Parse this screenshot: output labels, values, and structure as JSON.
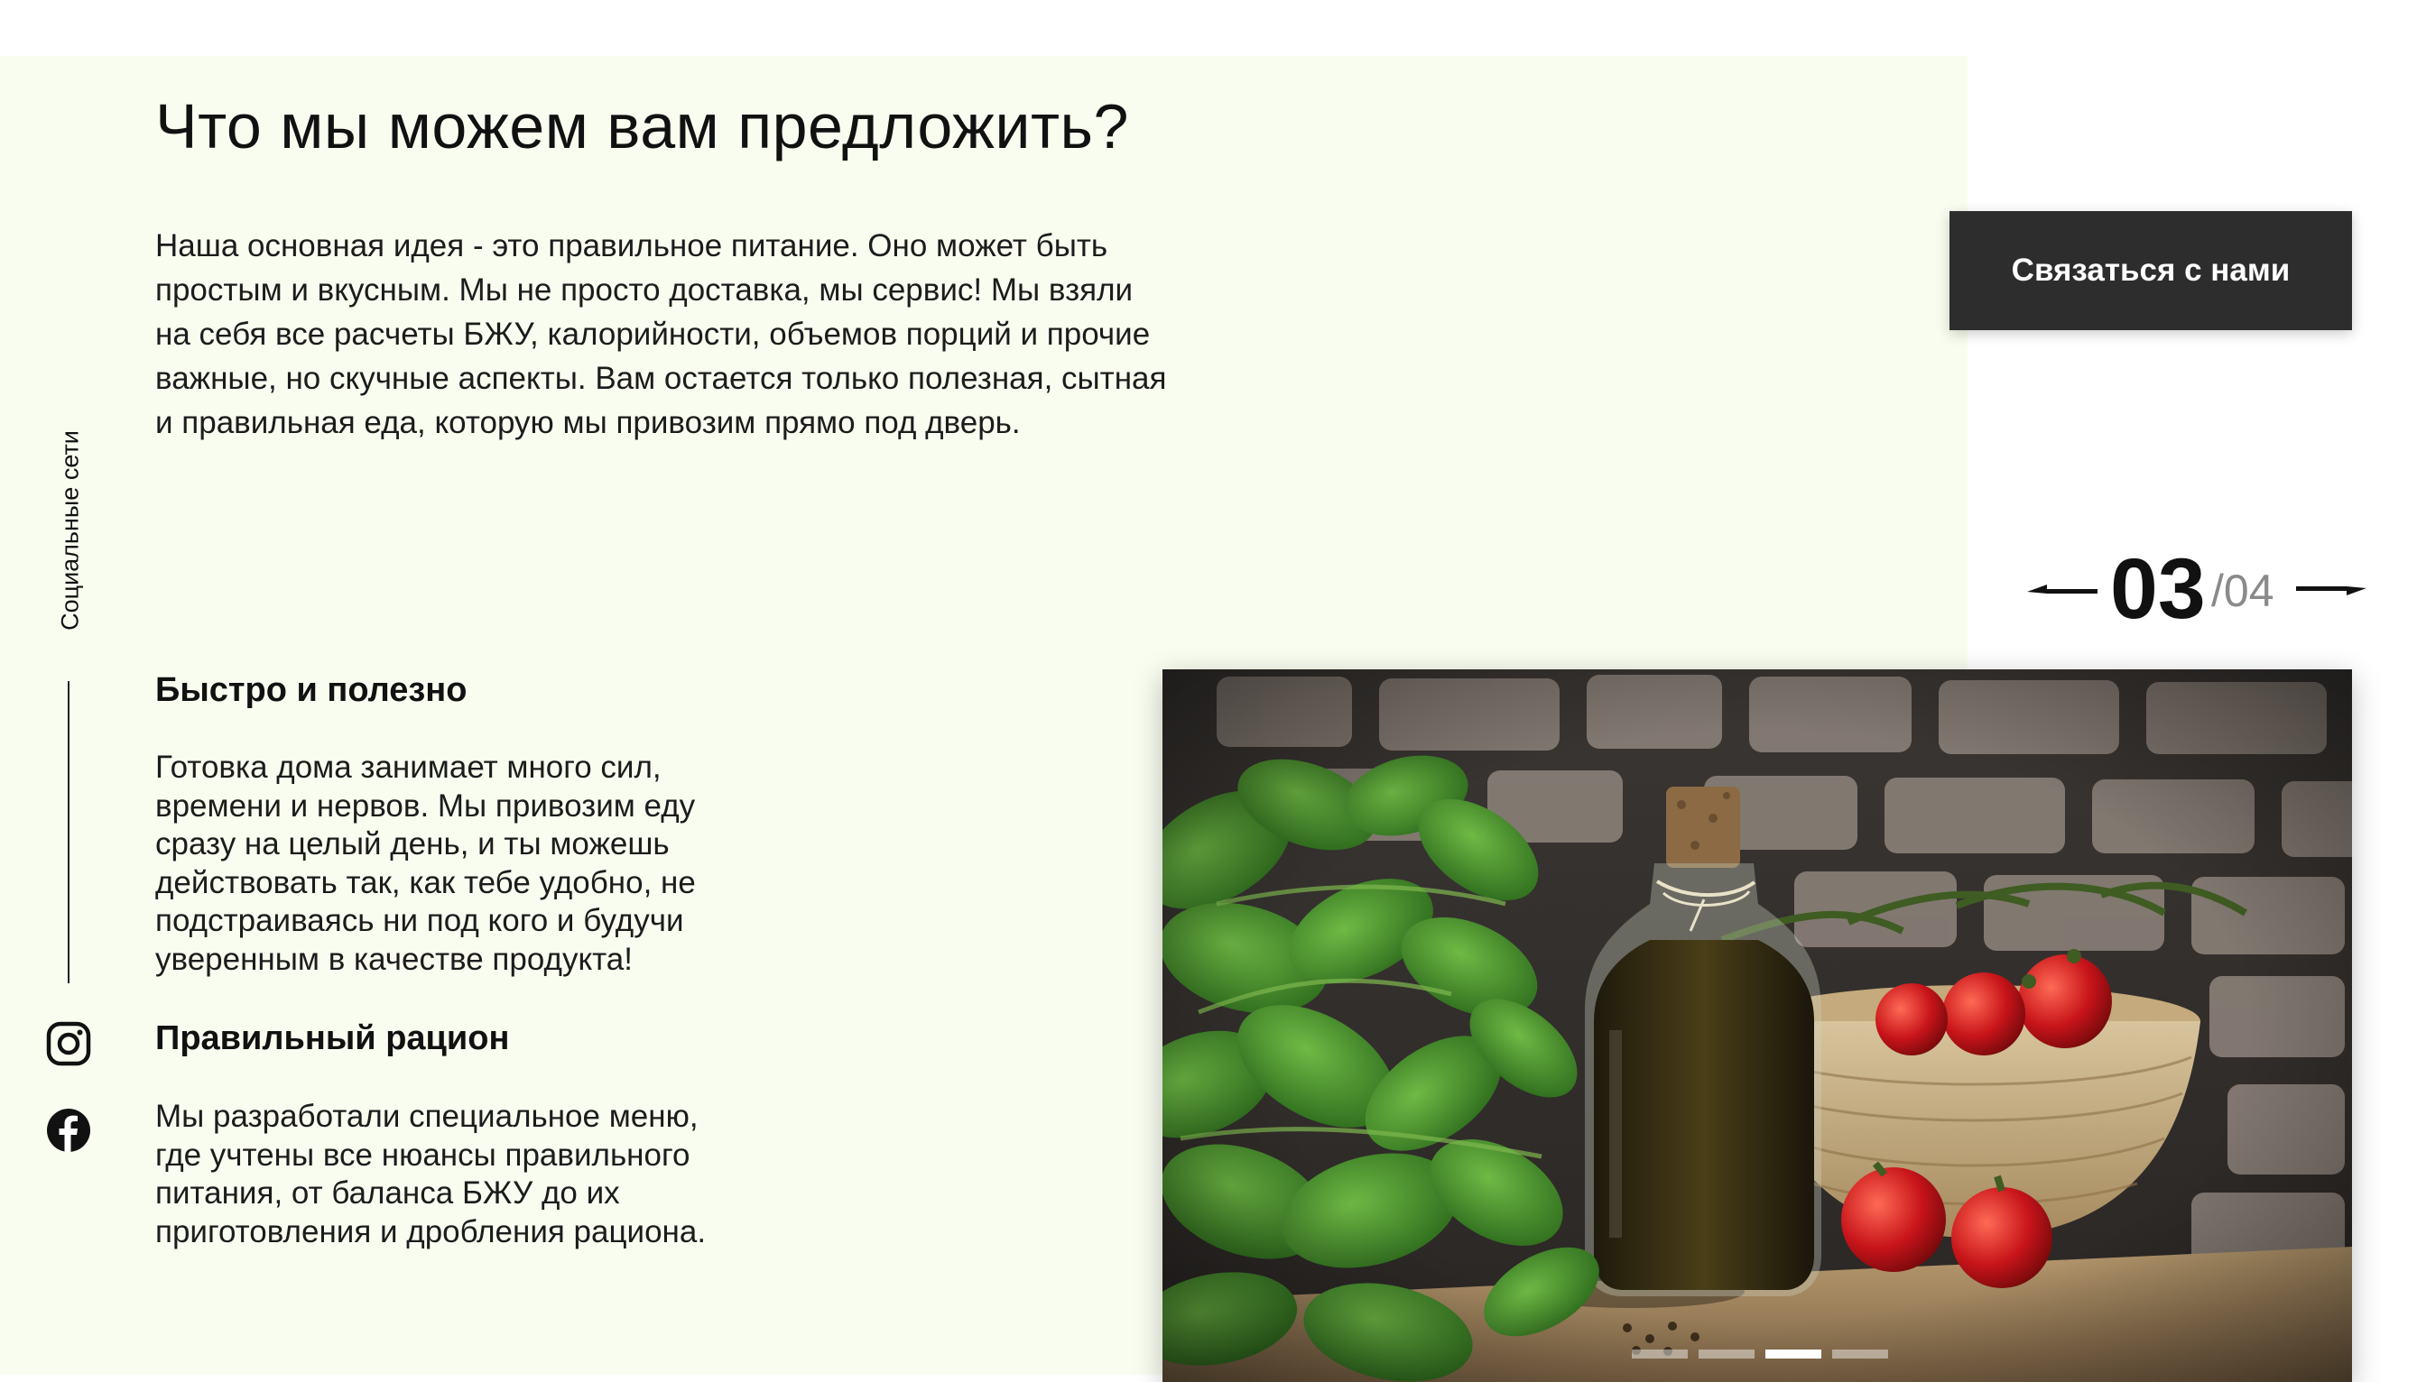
{
  "main": {
    "title": "Что мы можем вам предложить?",
    "intro_lines": [
      "Наша основная идея - это правильное питание. Оно может быть",
      "простым и вкусным. Мы не просто доставка, мы сервис! Мы взяли",
      "на себя все расчеты БЖУ, калорийности, объемов порций и прочие",
      "важные, но скучные аспекты. Вам остается только полезная, сытная",
      "и правильная еда, которую мы привозим прямо под дверь."
    ]
  },
  "features": [
    {
      "title": "Быстро и полезно",
      "lines": [
        "Готовка дома занимает много сил,",
        "времени и нервов. Мы привозим еду",
        "сразу на целый день, и ты можешь",
        "действовать так, как тебе удобно, не",
        "подстраиваясь ни под кого и будучи",
        "уверенным в качестве продукта!"
      ]
    },
    {
      "title": "Правильный рацион",
      "lines": [
        "Мы разработали специальное меню,",
        "где учтены все нюансы правильного",
        "питания, от баланса БЖУ до их",
        "приготовления и дробления рациона."
      ]
    }
  ],
  "social": {
    "label": "Социальные сети",
    "icons": [
      "instagram-icon",
      "facebook-icon"
    ]
  },
  "contact_button": "Связаться с нами",
  "slider": {
    "current": "03",
    "total": "/04",
    "active_dot": 3,
    "dot_count": 4
  },
  "colors": {
    "panel_bg": "#f9fdf0",
    "button_bg": "#2d2d2d",
    "text": "#111111",
    "counter_total": "#8a8a8a"
  }
}
